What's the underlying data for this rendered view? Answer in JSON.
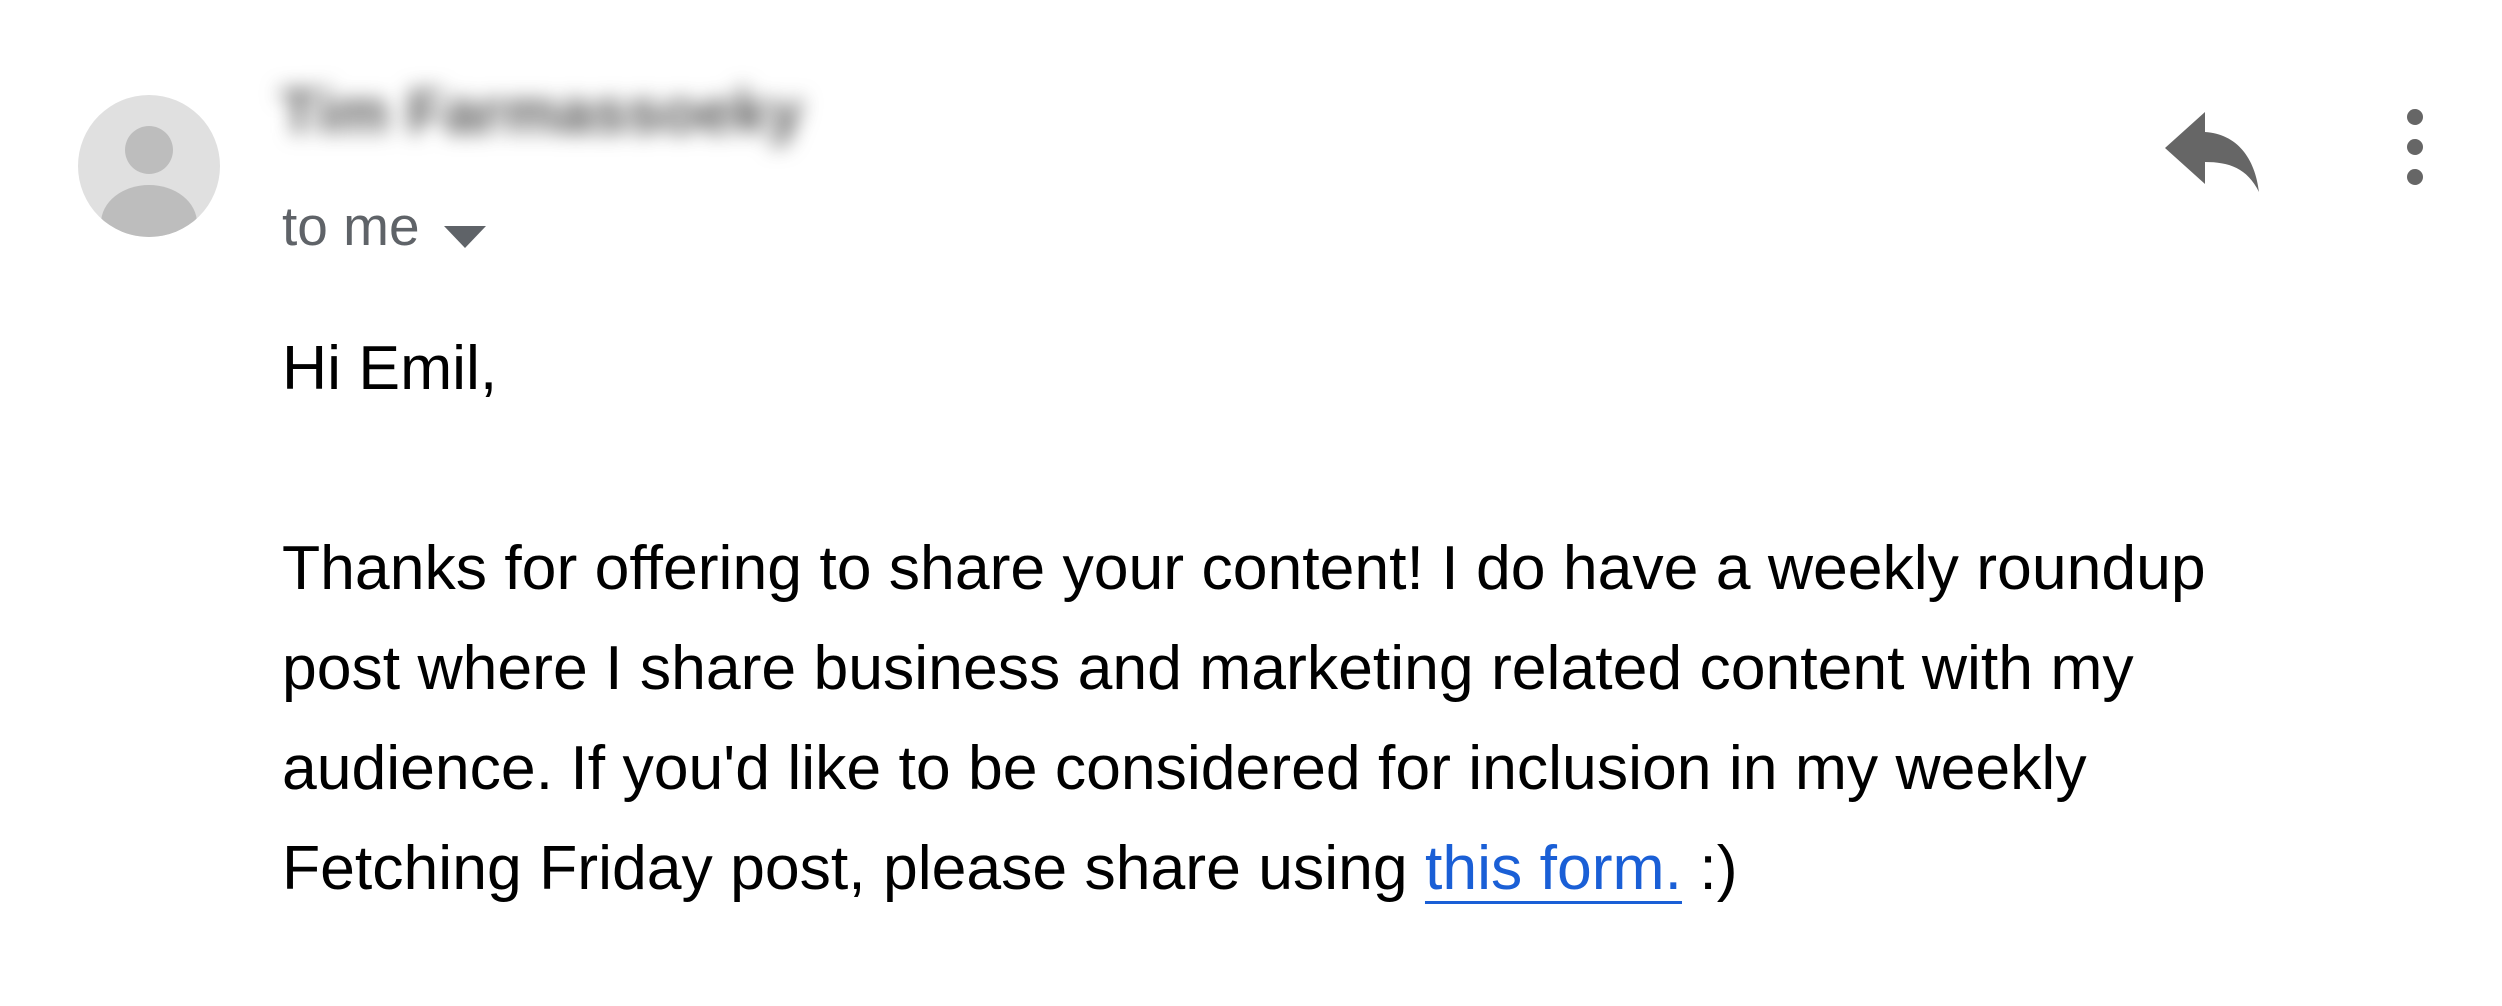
{
  "email": {
    "sender_name": "Tim Farmassoeky",
    "recipient_label": "to me",
    "greeting": "Hi Emil,",
    "body_lines": [
      "Thanks for offering to share your content! I do have a weekly roundup",
      "post where I share business and marketing related content with my",
      "audience. If you'd like to be considered for inclusion in my weekly"
    ],
    "last_line_prefix": "Fetching Friday post, please share using ",
    "link_text": "this form.",
    "last_line_suffix": " :)"
  },
  "icons": {
    "avatar": "person-avatar-icon",
    "recipient_caret": "caret-down-icon",
    "reply": "reply-icon",
    "more": "more-vertical-icon"
  },
  "colors": {
    "avatar_bg": "#e0e0e0",
    "avatar_fg": "#bdbdbd",
    "icon_gray": "#666666",
    "secondary_text": "#5f6368",
    "link": "#1a5fd6"
  }
}
